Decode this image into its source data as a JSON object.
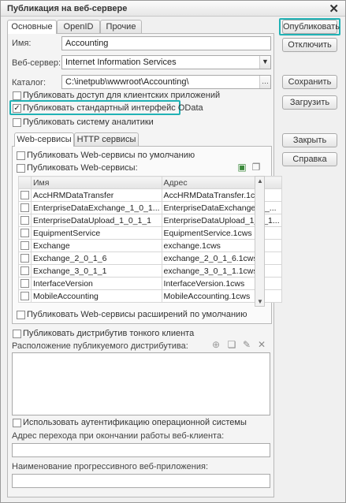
{
  "window": {
    "title": "Публикация на веб-сервере"
  },
  "tabs": [
    "Основные",
    "OpenID",
    "Прочие"
  ],
  "form": {
    "name_label": "Имя:",
    "name_value": "Accounting",
    "webserver_label": "Веб-сервер:",
    "webserver_value": "Internet Information Services",
    "catalog_label": "Каталог:",
    "catalog_value": "C:\\inetpub\\wwwroot\\Accounting\\",
    "cb_client_access": "Публиковать доступ для клиентских приложений",
    "cb_odata": "Публиковать стандартный интерфейс OData",
    "cb_analytics": "Публиковать систему аналитики"
  },
  "inner_tabs": [
    "Web-сервисы",
    "HTTP сервисы"
  ],
  "webservices": {
    "cb_default": "Публиковать Web-сервисы по умолчанию",
    "cb_publish": "Публиковать Web-сервисы:",
    "col_name": "Имя",
    "col_address": "Адрес",
    "rows": [
      {
        "name": "AccHRMDataTransfer",
        "address": "AccHRMDataTransfer.1cws"
      },
      {
        "name": "EnterpriseDataExchange_1_0_1...",
        "address": "EnterpriseDataExchange_1_..."
      },
      {
        "name": "EnterpriseDataUpload_1_0_1_1",
        "address": "EnterpriseDataUpload_1_0_1..."
      },
      {
        "name": "EquipmentService",
        "address": "EquipmentService.1cws"
      },
      {
        "name": "Exchange",
        "address": "exchange.1cws"
      },
      {
        "name": "Exchange_2_0_1_6",
        "address": "exchange_2_0_1_6.1cws"
      },
      {
        "name": "Exchange_3_0_1_1",
        "address": "exchange_3_0_1_1.1cws"
      },
      {
        "name": "InterfaceVersion",
        "address": "InterfaceVersion.1cws"
      },
      {
        "name": "MobileAccounting",
        "address": "MobileAccounting.1cws"
      }
    ],
    "cb_extensions": "Публиковать Web-сервисы расширений по умолчанию"
  },
  "distrib": {
    "cb_thin_client": "Публиковать дистрибутив тонкого клиента",
    "location_label": "Расположение публикуемого дистрибутива:"
  },
  "auth": {
    "cb_os_auth": "Использовать аутентификацию операционной системы",
    "redirect_label": "Адрес перехода при окончании работы веб-клиента:",
    "pwa_label": "Наименование прогрессивного веб-приложения:"
  },
  "buttons": {
    "publish": "Опубликовать",
    "unpublish": "Отключить",
    "save": "Сохранить",
    "load": "Загрузить",
    "close": "Закрыть",
    "help": "Справка"
  },
  "icons": {
    "close": "close-icon",
    "browse": "ellipsis-icon",
    "dropdown": "dropdown-arrow-icon",
    "check_all": "check-all-icon",
    "uncheck_all": "uncheck-all-icon",
    "add": "add-icon",
    "copy": "copy-icon",
    "edit": "edit-icon",
    "delete": "delete-icon"
  },
  "colors": {
    "highlight": "#21b2b5"
  }
}
